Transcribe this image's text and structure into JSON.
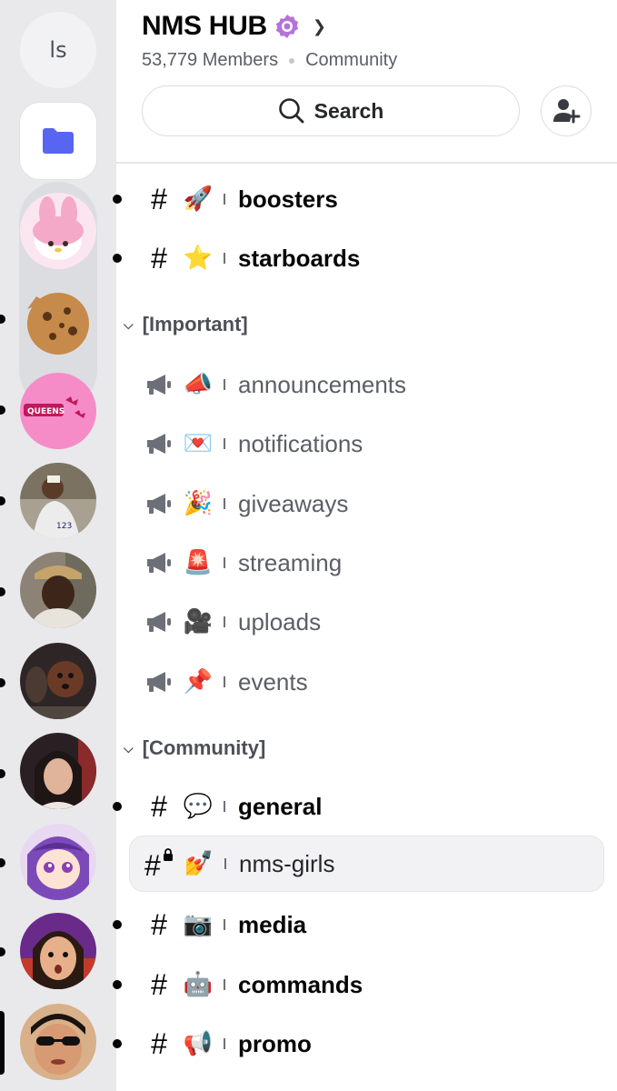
{
  "rail": {
    "home_label": "ls",
    "servers": [
      {
        "name": "folder",
        "icon": "folder-icon",
        "color": "#5865f2"
      },
      {
        "name": "server-pink-bunny",
        "color": "#f7c8dc"
      },
      {
        "name": "server-cookie",
        "color": "#c68a4a"
      },
      {
        "name": "server-queens",
        "color": "#f27bbf"
      },
      {
        "name": "server-avatar-1",
        "color": "#8a7a66"
      },
      {
        "name": "server-avatar-2",
        "color": "#6b5544"
      },
      {
        "name": "server-avatar-3",
        "color": "#3d2b24"
      },
      {
        "name": "server-avatar-4",
        "color": "#8a5a4a"
      },
      {
        "name": "server-avatar-5",
        "color": "#7c4ab8"
      },
      {
        "name": "server-avatar-6",
        "color": "#b5472e"
      },
      {
        "name": "server-avatar-7",
        "color": "#a86c4c"
      }
    ]
  },
  "header": {
    "server_name": "NMS HUB",
    "members": "53,779 Members",
    "type": "Community",
    "search_label": "Search",
    "badge_color": "#b473d8"
  },
  "channels_top": [
    {
      "emoji": "🚀",
      "name": "boosters",
      "unread": true
    },
    {
      "emoji": "⭐",
      "name": "starboards",
      "unread": true
    }
  ],
  "category_important": {
    "label": "[Important]",
    "channels": [
      {
        "emoji": "📣",
        "name": "announcements"
      },
      {
        "emoji": "💌",
        "name": "notifications"
      },
      {
        "emoji": "🎉",
        "name": "giveaways"
      },
      {
        "emoji": "🚨",
        "name": "streaming"
      },
      {
        "emoji": "🎥",
        "name": "uploads"
      },
      {
        "emoji": "📌",
        "name": "events"
      }
    ]
  },
  "category_community": {
    "label": "[Community]",
    "channels": [
      {
        "emoji": "💬",
        "name": "general",
        "unread": true
      },
      {
        "emoji": "💅",
        "name": "nms-girls",
        "selected": true,
        "locked": true
      },
      {
        "emoji": "📷",
        "name": "media",
        "unread": true
      },
      {
        "emoji": "🤖",
        "name": "commands",
        "unread": true
      },
      {
        "emoji": "📢",
        "name": "promo",
        "unread": true
      }
    ]
  }
}
